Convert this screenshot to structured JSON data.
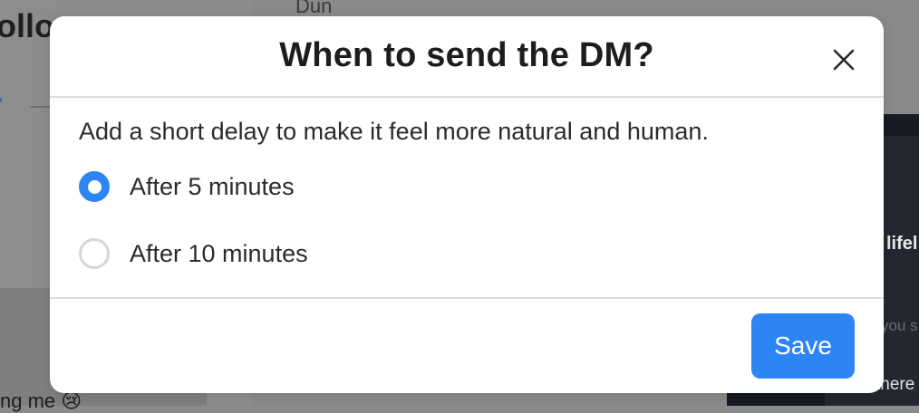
{
  "background": {
    "title_fragment": "ollo",
    "top_fragment": "Dun",
    "chevron_glyph": "›",
    "bottom_fragment": "ng me 😢",
    "right_fragment_1": "lifel",
    "right_fragment_2": "you s",
    "right_fragment_3": "there"
  },
  "dialog": {
    "title": "When to send the DM?",
    "close_icon": "close-icon",
    "description": "Add a short delay to make it feel more natural and human.",
    "options": [
      {
        "label": "After 5 minutes",
        "selected": true
      },
      {
        "label": "After 10 minutes",
        "selected": false
      }
    ],
    "save_label": "Save",
    "accent_color": "#2d85f5"
  }
}
